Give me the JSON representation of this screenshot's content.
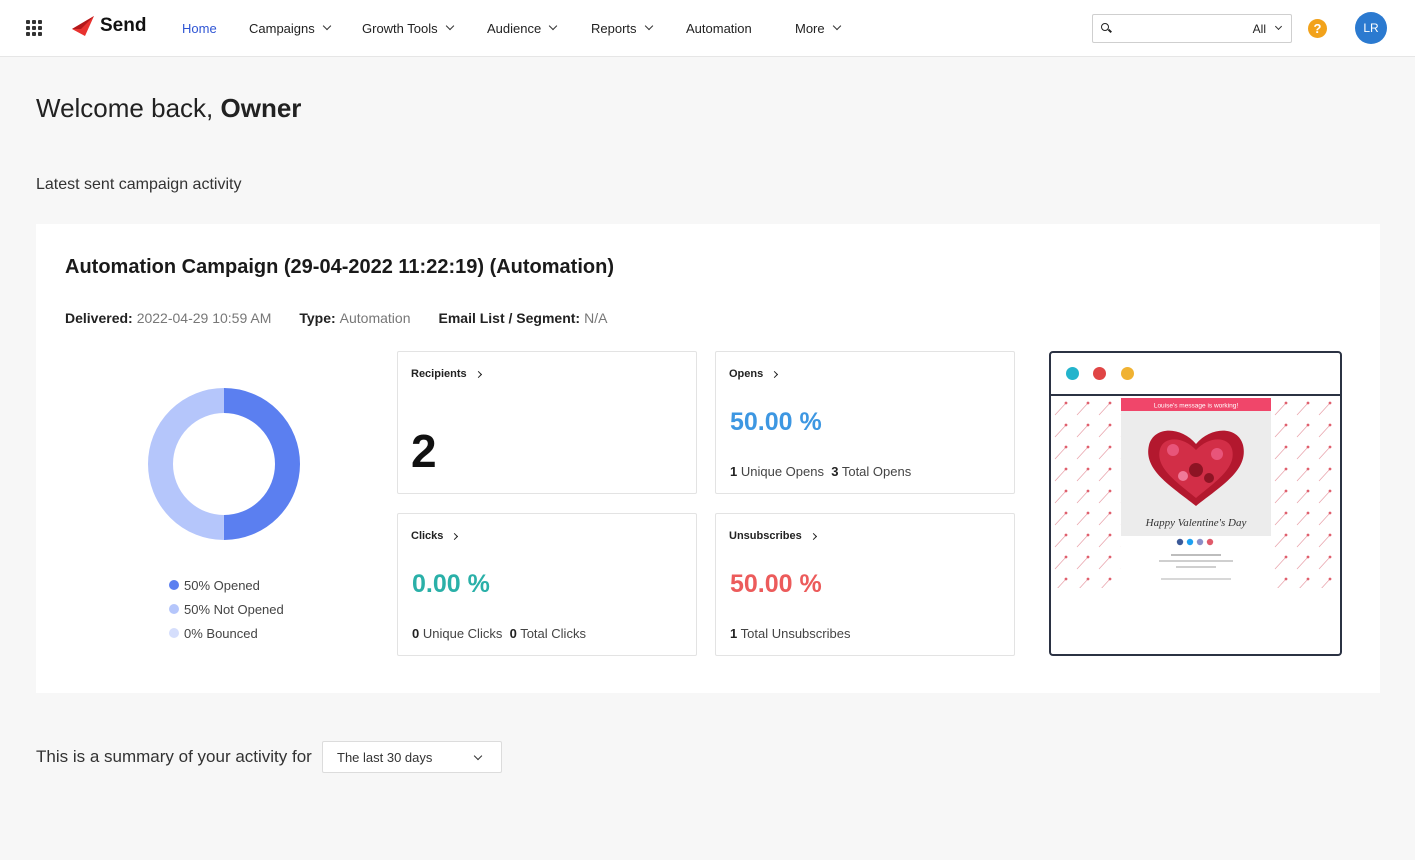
{
  "brand": {
    "name": "Send"
  },
  "nav": [
    {
      "label": "Home",
      "active": true,
      "dropdown": false
    },
    {
      "label": "Campaigns",
      "active": false,
      "dropdown": true
    },
    {
      "label": "Growth Tools",
      "active": false,
      "dropdown": true
    },
    {
      "label": "Audience",
      "active": false,
      "dropdown": true
    },
    {
      "label": "Reports",
      "active": false,
      "dropdown": true
    },
    {
      "label": "Automation",
      "active": false,
      "dropdown": false
    },
    {
      "label": "More",
      "active": false,
      "dropdown": true
    }
  ],
  "search": {
    "value": "",
    "scope": "All"
  },
  "help": {
    "label": "?"
  },
  "user": {
    "initials": "LR"
  },
  "welcome": {
    "prefix": "Welcome back,",
    "name": "Owner"
  },
  "latest_section_title": "Latest sent campaign activity",
  "campaign": {
    "title": "Automation Campaign (29-04-2022 11:22:19) (Automation)",
    "delivered_label": "Delivered:",
    "delivered_value": "2022-04-29 10:59 AM",
    "type_label": "Type:",
    "type_value": "Automation",
    "list_label": "Email List / Segment:",
    "list_value": "N/A"
  },
  "chart_data": {
    "type": "pie",
    "categories": [
      "Opened",
      "Not Opened",
      "Bounced"
    ],
    "values": [
      50,
      50,
      0
    ],
    "legend": [
      "50% Opened",
      "50% Not Opened",
      "0% Bounced"
    ],
    "colors": [
      "#5b7ff0",
      "#b5c6fb",
      "#d5defc"
    ],
    "legend_placement": "bottom"
  },
  "stats": {
    "recipients": {
      "title": "Recipients",
      "value": "2"
    },
    "opens": {
      "title": "Opens",
      "percent": "50.00 %",
      "unique": "1",
      "unique_label": "Unique Opens",
      "total": "3",
      "total_label": "Total Opens",
      "color": "#3d97e2"
    },
    "clicks": {
      "title": "Clicks",
      "percent": "0.00 %",
      "unique": "0",
      "unique_label": "Unique Clicks",
      "total": "0",
      "total_label": "Total Clicks",
      "color": "#2ab0a8"
    },
    "unsubscribes": {
      "title": "Unsubscribes",
      "percent": "50.00 %",
      "total": "1",
      "total_label": "Total Unsubscribes",
      "color": "#ec5b5b"
    }
  },
  "preview": {
    "banner": "Louise's message is working!",
    "greeting": "Happy Valentine's Day",
    "window_dot_colors": [
      "#23b4cc",
      "#e04545",
      "#f0b232"
    ]
  },
  "summary": {
    "text": "This is a summary of your activity for",
    "range": "The last 30 days"
  }
}
